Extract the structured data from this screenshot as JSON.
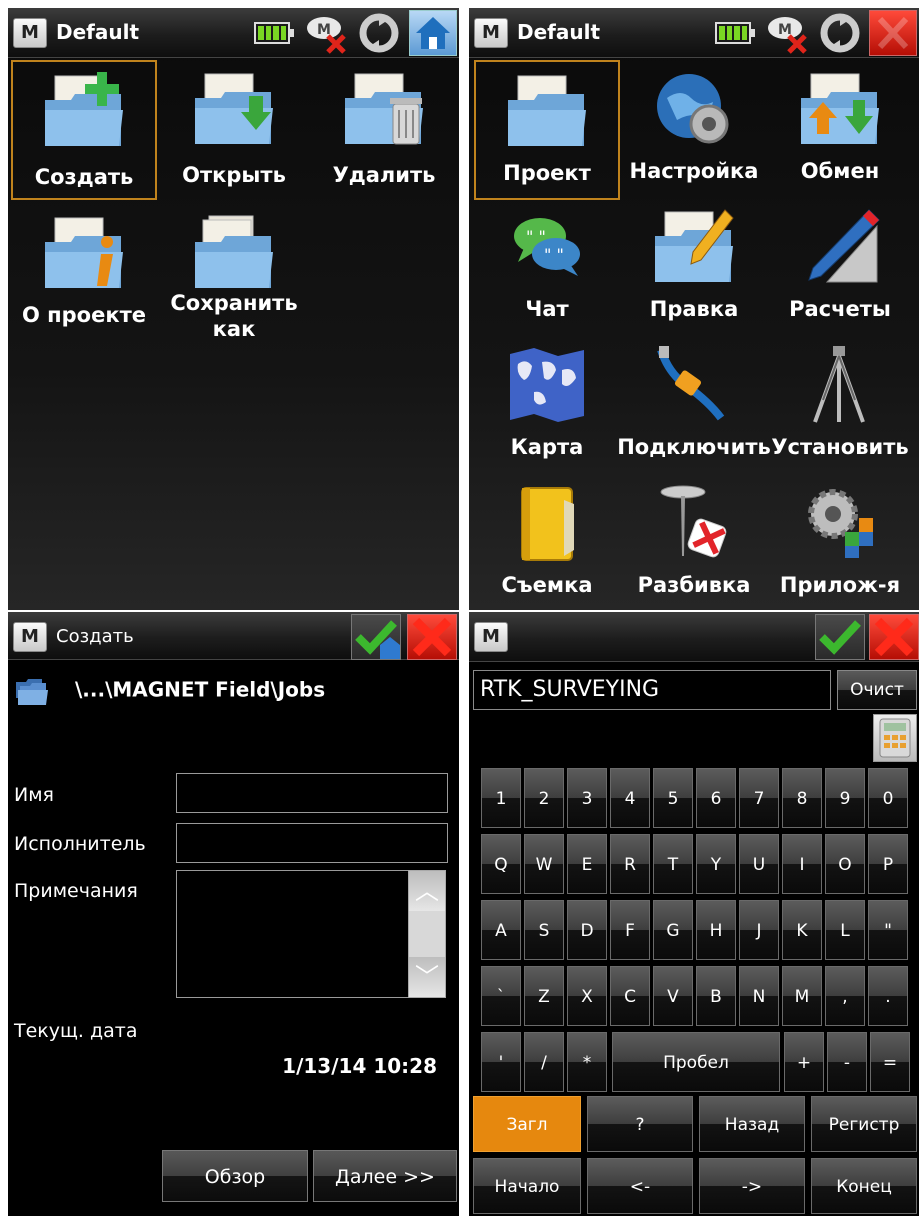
{
  "top_left": {
    "title": "Default",
    "tiles": [
      {
        "label": "Создать",
        "icon": "folder-new-icon"
      },
      {
        "label": "Открыть",
        "icon": "folder-open-icon"
      },
      {
        "label": "Удалить",
        "icon": "folder-delete-icon"
      },
      {
        "label": "О проекте",
        "icon": "folder-info-icon"
      },
      {
        "label_line1": "Сохранить",
        "label_line2": "как",
        "icon": "folder-saveas-icon"
      }
    ]
  },
  "top_right": {
    "title": "Default",
    "tiles": [
      {
        "label": "Проект",
        "icon": "folder-icon"
      },
      {
        "label": "Настройка",
        "icon": "globe-gear-icon"
      },
      {
        "label": "Обмен",
        "icon": "folder-exchange-icon"
      },
      {
        "label": "Чат",
        "icon": "chat-bubbles-icon"
      },
      {
        "label": "Правка",
        "icon": "folder-edit-icon"
      },
      {
        "label": "Расчеты",
        "icon": "pencil-ruler-icon"
      },
      {
        "label": "Карта",
        "icon": "map-icon"
      },
      {
        "label": "Подключить",
        "icon": "cable-icon"
      },
      {
        "label": "Установить",
        "icon": "tripod-icon"
      },
      {
        "label": "Съемка",
        "icon": "notebook-icon"
      },
      {
        "label": "Разбивка",
        "icon": "stakeout-icon"
      },
      {
        "label": "Прилож-я",
        "icon": "apps-gear-icon"
      }
    ]
  },
  "bottom_left": {
    "title": "Создать",
    "path": "\\...\\MAGNET Field\\Jobs",
    "fields": {
      "name_label": "Имя",
      "name_value": "",
      "performer_label": "Исполнитель",
      "performer_value": "",
      "notes_label": "Примечания",
      "date_label": "Текущ. дата",
      "date_value": "1/13/14 10:28"
    },
    "buttons": {
      "browse": "Обзор",
      "next": "Далее >>"
    }
  },
  "bottom_right": {
    "input_value": "RTK_SURVEYING",
    "clear_label": "Очист",
    "rows": [
      [
        "1",
        "2",
        "3",
        "4",
        "5",
        "6",
        "7",
        "8",
        "9",
        "0"
      ],
      [
        "Q",
        "W",
        "E",
        "R",
        "T",
        "Y",
        "U",
        "I",
        "O",
        "P"
      ],
      [
        "A",
        "S",
        "D",
        "F",
        "G",
        "H",
        "J",
        "K",
        "L",
        "\""
      ],
      [
        "`",
        "Z",
        "X",
        "C",
        "V",
        "B",
        "N",
        "M",
        ",",
        "."
      ]
    ],
    "row5": {
      "k1": "'",
      "k2": "/",
      "k3": "*",
      "space": "Пробел",
      "k4": "+",
      "k5": "-",
      "k6": "="
    },
    "fn1": {
      "caps": "Загл",
      "q": "?",
      "back": "Назад",
      "shift": "Регистр"
    },
    "fn2": {
      "home": "Начало",
      "left": "<-",
      "right": "->",
      "end": "Конец"
    }
  },
  "colors": {
    "accent_orange": "#e6880e",
    "battery_green": "#7ad623",
    "cancel_red": "#d8180b"
  }
}
